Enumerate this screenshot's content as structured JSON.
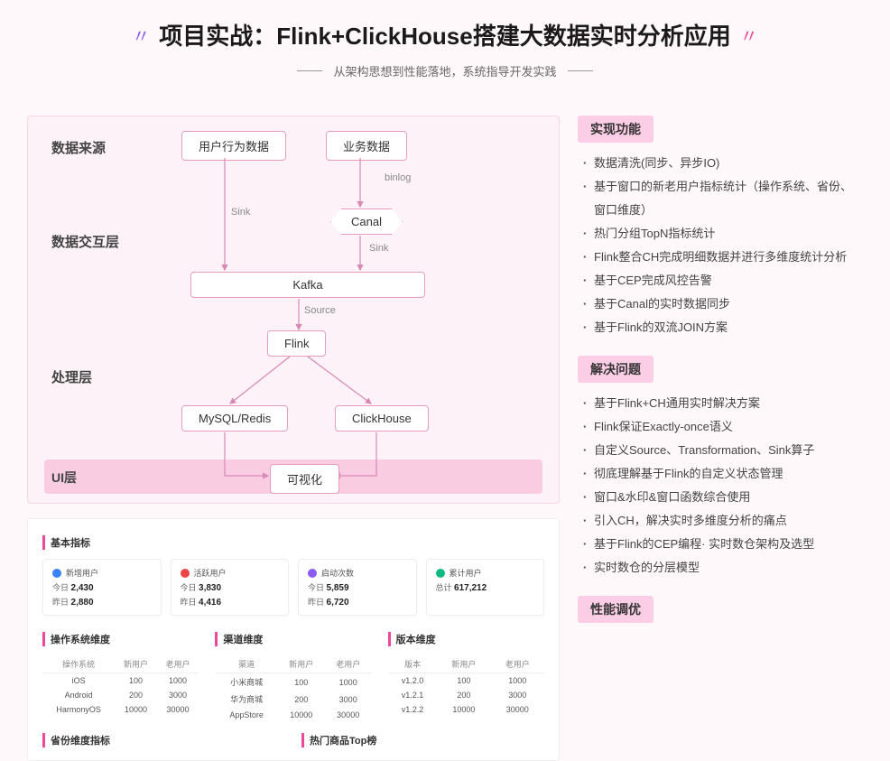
{
  "header": {
    "title": "项目实战：Flink+ClickHouse搭建大数据实时分析应用",
    "subtitle": "从架构思想到性能落地，系统指导开发实践"
  },
  "diagram": {
    "layers": {
      "source": "数据来源",
      "exchange": "数据交互层",
      "process": "处理层",
      "ui": "UI层"
    },
    "nodes": {
      "user_behavior": "用户行为数据",
      "biz_data": "业务数据",
      "canal": "Canal",
      "kafka": "Kafka",
      "flink": "Flink",
      "mysql_redis": "MySQL/Redis",
      "clickhouse": "ClickHouse",
      "viz": "可视化"
    },
    "edges": {
      "binlog": "binlog",
      "sink1": "Sink",
      "sink2": "Sink",
      "source": "Source"
    }
  },
  "dashboard": {
    "basic_title": "基本指标",
    "cards": [
      {
        "color": "#3b82f6",
        "name": "新增用户",
        "l1_label": "今日",
        "l1_val": "2,430",
        "l2_label": "昨日",
        "l2_val": "2,880"
      },
      {
        "color": "#ef4444",
        "name": "活跃用户",
        "l1_label": "今日",
        "l1_val": "3,830",
        "l2_label": "昨日",
        "l2_val": "4,416"
      },
      {
        "color": "#8b5cf6",
        "name": "启动次数",
        "l1_label": "今日",
        "l1_val": "5,859",
        "l2_label": "昨日",
        "l2_val": "6,720"
      },
      {
        "color": "#10b981",
        "name": "累计用户",
        "l1_label": "总计",
        "l1_val": "617,212",
        "l2_label": "",
        "l2_val": ""
      }
    ],
    "os_title": "操作系统维度",
    "os_headers": [
      "操作系统",
      "新用户",
      "老用户"
    ],
    "os_rows": [
      [
        "iOS",
        "100",
        "1000"
      ],
      [
        "Android",
        "200",
        "3000"
      ],
      [
        "HarmonyOS",
        "10000",
        "30000"
      ]
    ],
    "channel_title": "渠道维度",
    "channel_headers": [
      "渠道",
      "新用户",
      "老用户"
    ],
    "channel_rows": [
      [
        "小米商城",
        "100",
        "1000"
      ],
      [
        "华为商城",
        "200",
        "3000"
      ],
      [
        "AppStore",
        "10000",
        "30000"
      ]
    ],
    "version_title": "版本维度",
    "version_headers": [
      "版本",
      "新用户",
      "老用户"
    ],
    "version_rows": [
      [
        "v1.2.0",
        "100",
        "1000"
      ],
      [
        "v1.2.1",
        "200",
        "3000"
      ],
      [
        "v1.2.2",
        "10000",
        "30000"
      ]
    ],
    "province_title": "省份维度指标",
    "top_title": "热门商品Top榜"
  },
  "sidebar": {
    "sections": [
      {
        "title": "实现功能",
        "items": [
          "数据清洗(同步、异步IO)",
          "基于窗口的新老用户指标统计（操作系统、省份、窗口维度）",
          "热门分组TopN指标统计",
          "Flink整合CH完成明细数据并进行多维度统计分析",
          "基于CEP完成风控告警",
          "基于Canal的实时数据同步",
          "基于Flink的双流JOIN方案"
        ]
      },
      {
        "title": "解决问题",
        "items": [
          "基于Flink+CH通用实时解决方案",
          "Flink保证Exactly-once语义",
          "自定义Source、Transformation、Sink算子",
          "彻底理解基于Flink的自定义状态管理",
          "窗口&水印&窗口函数综合使用",
          "引入CH，解决实时多维度分析的痛点",
          "基于Flink的CEP编程· 实时数仓架构及选型",
          "实时数仓的分层模型"
        ]
      },
      {
        "title": "性能调优",
        "items": []
      }
    ]
  }
}
